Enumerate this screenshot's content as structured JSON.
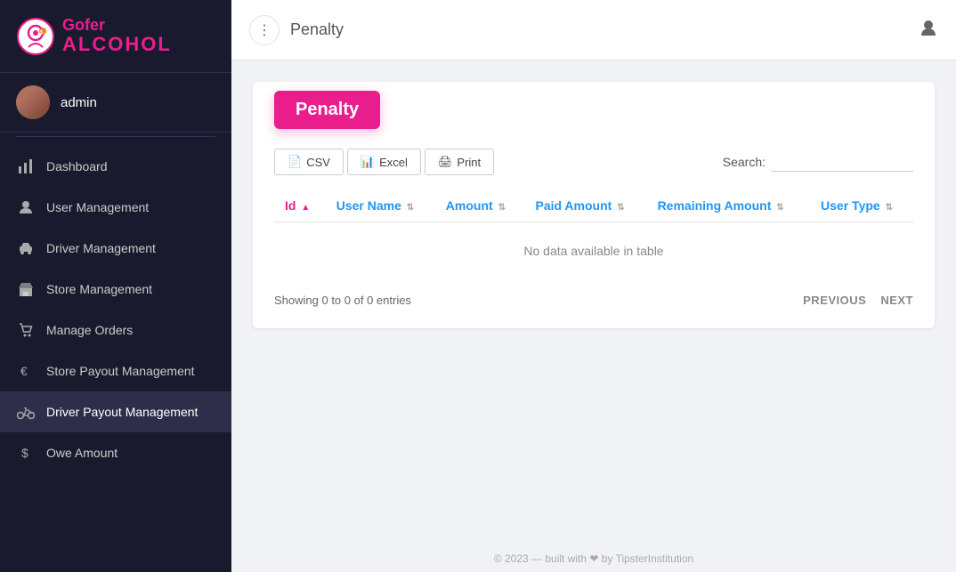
{
  "sidebar": {
    "logo": {
      "gofer": "Gofer",
      "alcohol": "ALCOHOL"
    },
    "user": {
      "name": "admin"
    },
    "nav": [
      {
        "id": "dashboard",
        "label": "Dashboard",
        "icon": "bar-chart"
      },
      {
        "id": "user-management",
        "label": "User Management",
        "icon": "person"
      },
      {
        "id": "driver-management",
        "label": "Driver Management",
        "icon": "car"
      },
      {
        "id": "store-management",
        "label": "Store Management",
        "icon": "store"
      },
      {
        "id": "manage-orders",
        "label": "Manage Orders",
        "icon": "cart"
      },
      {
        "id": "store-payout",
        "label": "Store Payout Management",
        "icon": "euro"
      },
      {
        "id": "driver-payout",
        "label": "Driver Payout Management",
        "icon": "motorbike"
      },
      {
        "id": "owe-amount",
        "label": "Owe Amount",
        "icon": "dollar"
      }
    ]
  },
  "topbar": {
    "title": "Penalty",
    "dots_label": "⋮",
    "user_icon": "👤"
  },
  "page": {
    "title": "Penalty",
    "toolbar": {
      "csv_label": "CSV",
      "excel_label": "Excel",
      "print_label": "Print",
      "search_label": "Search:"
    },
    "table": {
      "columns": [
        {
          "id": "id",
          "label": "Id",
          "sort": "asc",
          "color": "pink"
        },
        {
          "id": "username",
          "label": "User Name",
          "sort": "both",
          "color": "blue"
        },
        {
          "id": "amount",
          "label": "Amount",
          "sort": "both",
          "color": "blue"
        },
        {
          "id": "paid-amount",
          "label": "Paid Amount",
          "sort": "both",
          "color": "blue"
        },
        {
          "id": "remaining-amount",
          "label": "Remaining Amount",
          "sort": "both",
          "color": "blue"
        },
        {
          "id": "user-type",
          "label": "User Type",
          "sort": "both",
          "color": "blue"
        }
      ],
      "no_data_text": "No data available in table",
      "showing_text": "Showing 0 to 0 of 0 entries"
    },
    "pagination": {
      "previous": "PREVIOUS",
      "next": "NEXT"
    }
  },
  "footer": {
    "text": "© 2023 — built with ❤ by TipsterInstitution"
  }
}
